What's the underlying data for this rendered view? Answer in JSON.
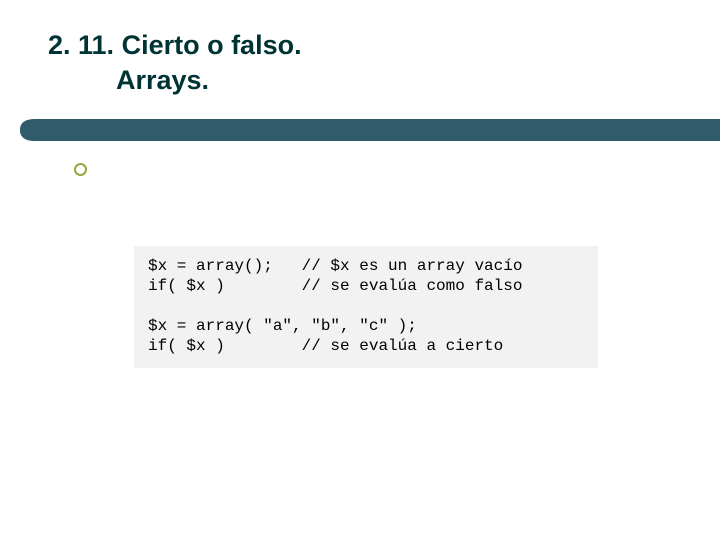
{
  "title": {
    "line1": "2. 11. Cierto o falso.",
    "line2": "Arrays."
  },
  "code": {
    "l1": "$x = array();   // $x es un array vacío",
    "l2": "if( $x )        // se evalúa como falso",
    "l3": "",
    "l4": "$x = array( \"a\", \"b\", \"c\" );",
    "l5": "if( $x )        // se evalúa a cierto"
  }
}
